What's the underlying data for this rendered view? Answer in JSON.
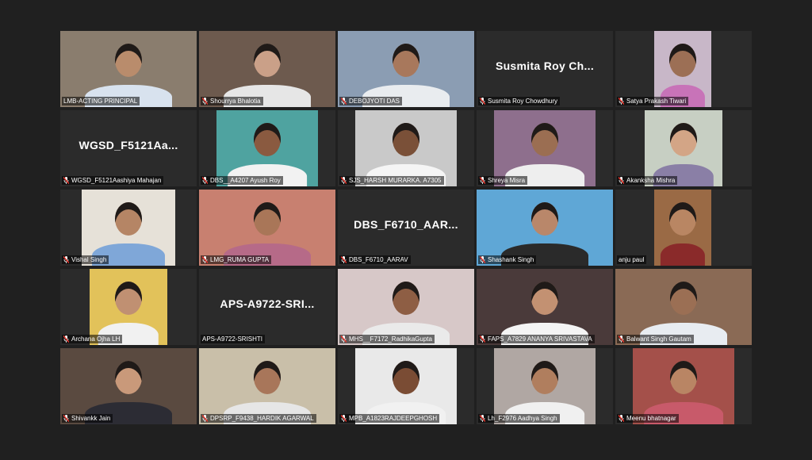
{
  "meeting": {
    "participants": [
      {
        "label": "LMB-ACTING PRINCIPAL",
        "video": true,
        "muted": false,
        "active": true,
        "bg": "#8a7d6e",
        "face": "#b98c6c",
        "shirt": "#d8e2ee"
      },
      {
        "label": "Shourrya Bhalotia",
        "video": true,
        "muted": true,
        "bg": "#6d5a4e",
        "face": "#caa088",
        "shirt": "#e6e6e6"
      },
      {
        "label": "DEBOJYOTI DAS",
        "video": true,
        "muted": true,
        "bg": "#8b9db3",
        "face": "#a8785c",
        "shirt": "#e9ecef"
      },
      {
        "label": "Susmita Roy Chowdhury",
        "display_name": "Susmita Roy Ch...",
        "video": false,
        "muted": true
      },
      {
        "label": "Satya Prakash Tiwari",
        "video": true,
        "muted": true,
        "bg": "#c8b7c8",
        "face": "#9c6f55",
        "shirt": "#c873b8"
      },
      {
        "label": "WGSD_F5121Aashiya Mahajan",
        "display_name": "WGSD_F5121Aa...",
        "video": false,
        "muted": true
      },
      {
        "label": "DBS__A4207 Ayush Roy",
        "video": true,
        "muted": true,
        "bg": "#4fa3a0",
        "face": "#8a5a40",
        "shirt": "#f2f2f2"
      },
      {
        "label": "SJS_HARSH MURARKA. A7305",
        "video": true,
        "muted": true,
        "bg": "#c9c9c9",
        "face": "#7a5038",
        "shirt": "#f5f5f5"
      },
      {
        "label": "Shreya Misra",
        "video": true,
        "muted": true,
        "bg": "#8e6f8d",
        "face": "#9b6e52",
        "shirt": "#eeeeee"
      },
      {
        "label": "Akanksha Mishra",
        "video": true,
        "muted": true,
        "bg": "#c7cfc3",
        "face": "#d3a586",
        "shirt": "#8a7fa6"
      },
      {
        "label": "Vishal Singh",
        "video": true,
        "muted": true,
        "bg": "#e6e1d8",
        "face": "#b58565",
        "shirt": "#7fa7d8"
      },
      {
        "label": "LMG_RUMA GUPTA",
        "video": true,
        "muted": true,
        "bg": "#c88070",
        "face": "#a97658",
        "shirt": "#b66a88"
      },
      {
        "label": "DBS_F6710_AARAV",
        "display_name": "DBS_F6710_AAR...",
        "video": false,
        "muted": true
      },
      {
        "label": "Shashank Singh",
        "video": true,
        "muted": true,
        "bg": "#5fa7d6",
        "face": "#b9876a",
        "shirt": "#2a2a2a"
      },
      {
        "label": "anju paul",
        "video": true,
        "muted": false,
        "bg": "#9a6a45",
        "face": "#b98663",
        "shirt": "#8a2a2a"
      },
      {
        "label": "Archana Ojha LH",
        "video": true,
        "muted": true,
        "bg": "#e2c25a",
        "face": "#c09072",
        "shirt": "#f1f1f1"
      },
      {
        "label": "APS-A9722-SRISHTI",
        "display_name": "APS-A9722-SRI...",
        "video": false,
        "muted": false
      },
      {
        "label": "MHS__F7172_RadhikaGupta",
        "video": true,
        "muted": true,
        "bg": "#d7c8c8",
        "face": "#8e5e44",
        "shirt": "#eaeaea"
      },
      {
        "label": "FAPS_A7829 ANANYA SRIVASTAVA",
        "video": true,
        "muted": true,
        "bg": "#4a3a3a",
        "face": "#c39172",
        "shirt": "#f4f4f4"
      },
      {
        "label": "Balwant Singh Gautam",
        "video": true,
        "muted": true,
        "bg": "#8a6a55",
        "face": "#9b6f54",
        "shirt": "#e8ecf1"
      },
      {
        "label": "Shivankk Jain",
        "video": true,
        "muted": true,
        "bg": "#5a4a40",
        "face": "#c9997a",
        "shirt": "#2c2c34"
      },
      {
        "label": "DPSRP_F9438_HARDIK AGARWAL",
        "video": true,
        "muted": true,
        "speaking": true,
        "bg": "#c9bfa9",
        "face": "#a8765a",
        "shirt": "#e6e6e6"
      },
      {
        "label": "MPB_A1823RAJDEEPGHOSH",
        "video": true,
        "muted": true,
        "bg": "#e9e9e9",
        "face": "#7a4c34",
        "shirt": "#f1f1f1"
      },
      {
        "label": "Lh_F2976 Aadhya Singh",
        "video": true,
        "muted": true,
        "bg": "#b0a7a3",
        "face": "#b07e5e",
        "shirt": "#f0f0f0"
      },
      {
        "label": "Meenu bhatnagar",
        "video": true,
        "muted": true,
        "bg": "#a4504a",
        "face": "#b98564",
        "shirt": "#c85a6a"
      }
    ]
  }
}
